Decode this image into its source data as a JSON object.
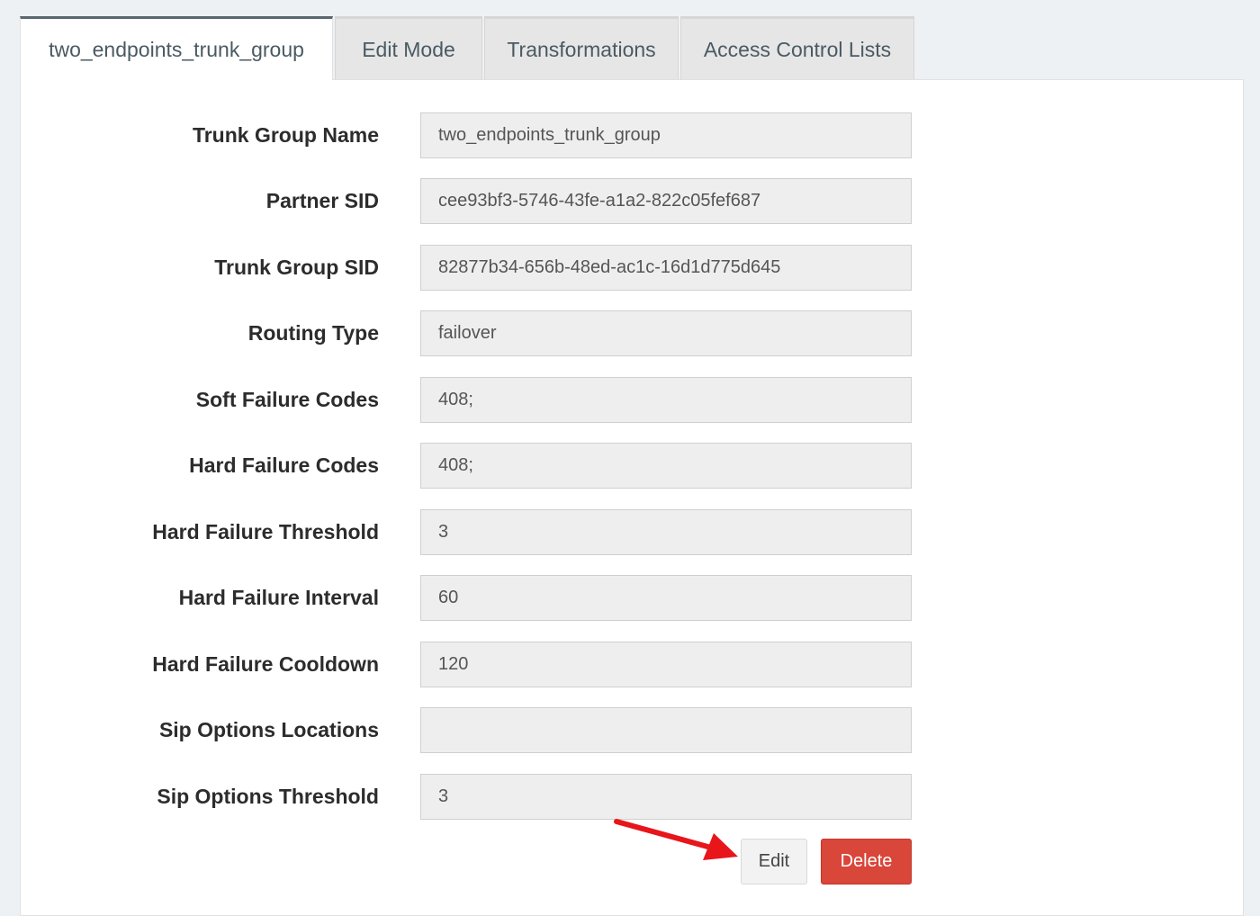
{
  "tabs": [
    {
      "label": "two_endpoints_trunk_group",
      "active": true
    },
    {
      "label": "Edit Mode",
      "active": false
    },
    {
      "label": "Transformations",
      "active": false
    },
    {
      "label": "Access Control Lists",
      "active": false
    }
  ],
  "fields": [
    {
      "label": "Trunk Group Name",
      "value": "two_endpoints_trunk_group"
    },
    {
      "label": "Partner SID",
      "value": "cee93bf3-5746-43fe-a1a2-822c05fef687"
    },
    {
      "label": "Trunk Group SID",
      "value": "82877b34-656b-48ed-ac1c-16d1d775d645"
    },
    {
      "label": "Routing Type",
      "value": "failover"
    },
    {
      "label": "Soft Failure Codes",
      "value": "408;"
    },
    {
      "label": "Hard Failure Codes",
      "value": "408;"
    },
    {
      "label": "Hard Failure Threshold",
      "value": "3"
    },
    {
      "label": "Hard Failure Interval",
      "value": "60"
    },
    {
      "label": "Hard Failure Cooldown",
      "value": "120"
    },
    {
      "label": "Sip Options Locations",
      "value": ""
    },
    {
      "label": "Sip Options Threshold",
      "value": "3"
    }
  ],
  "actions": {
    "edit_label": "Edit",
    "delete_label": "Delete"
  },
  "colors": {
    "delete_button": "#d9463a",
    "annotation_arrow": "#e8151b"
  }
}
